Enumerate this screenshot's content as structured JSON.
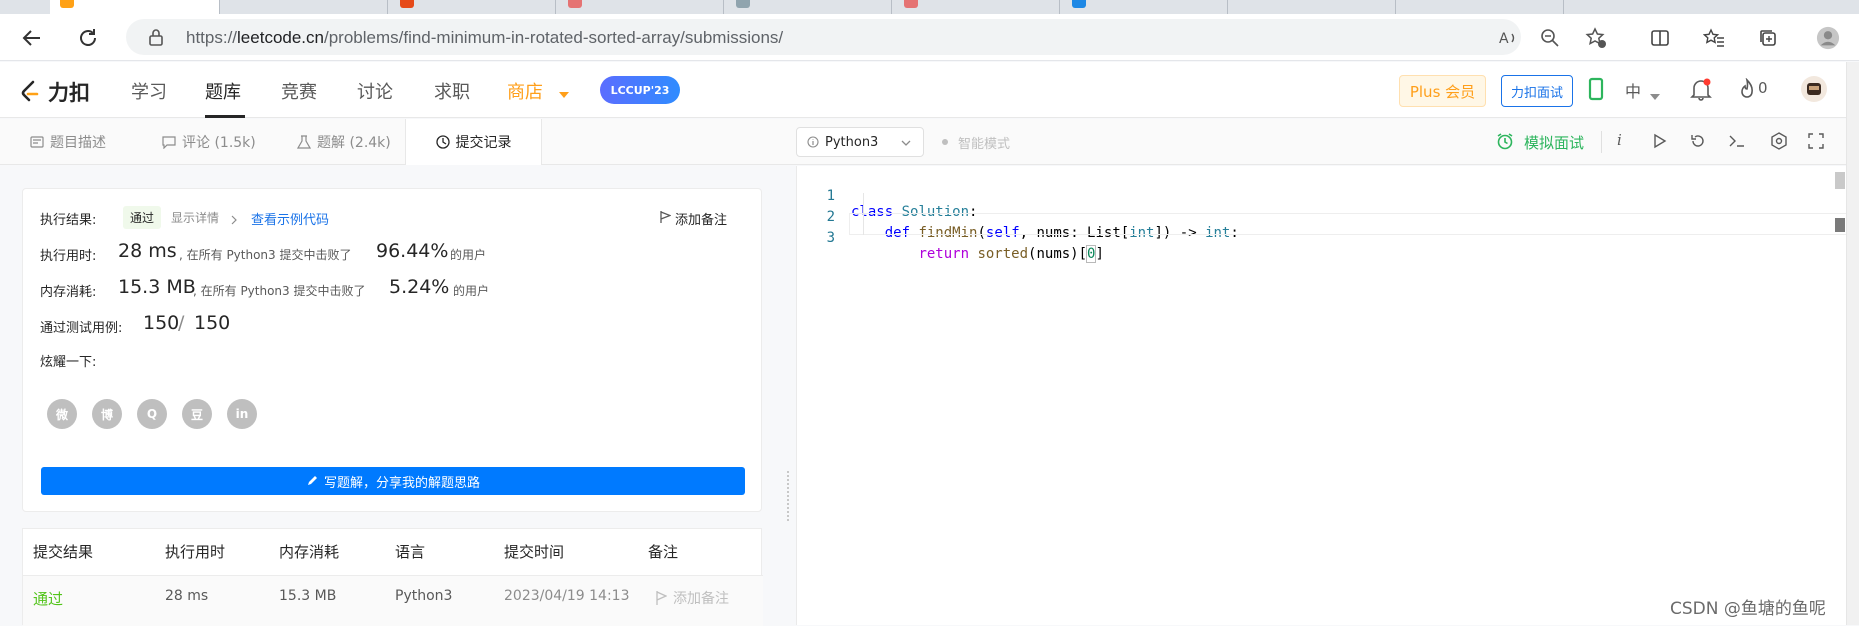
{
  "browser": {
    "url_prefix": "https://",
    "url_host": "leetcode.cn",
    "url_path": "/problems/find-minimum-in-rotated-sorted-array/submissions/"
  },
  "site_nav": {
    "logo_text": "力扣",
    "items": [
      "学习",
      "题库",
      "竞赛",
      "讨论",
      "求职",
      "商店"
    ],
    "lccup_badge": "LCCUP'23",
    "plus_label": "Plus 会员",
    "interview_label": "力扣面试",
    "lang_toggle": "中",
    "fire_count": "0"
  },
  "sub_tabs": {
    "description": "题目描述",
    "comments": "评论 (1.5k)",
    "solutions": "题解 (2.4k)",
    "submissions": "提交记录"
  },
  "editor_toolbar": {
    "language": "Python3",
    "smart_mode": "智能模式",
    "mock_interview": "模拟面试"
  },
  "result_card": {
    "result_label": "执行结果:",
    "status": "通过",
    "show_details": "显示详情",
    "view_sample": "查看示例代码",
    "add_note": "添加备注",
    "runtime_label": "执行用时:",
    "runtime_value": "28 ms",
    "runtime_mid": ", 在所有 Python3 提交中击败了",
    "runtime_pct": "96.44%",
    "runtime_suffix": "的用户",
    "memory_label": "内存消耗:",
    "memory_value": "15.3 MB",
    "memory_mid": ", 在所有 Python3 提交中击败了",
    "memory_pct": "5.24%",
    "memory_suffix": "的用户",
    "tests_label": "通过测试用例:",
    "tests_passed": "150",
    "tests_sep": "/",
    "tests_total": "150",
    "share_label": "炫耀一下:",
    "share_icons": [
      "wechat-icon",
      "weibo-icon",
      "qq-icon",
      "douban-icon",
      "linkedin-icon"
    ],
    "share_glyphs": [
      "微",
      "博",
      "Q",
      "豆",
      "in"
    ],
    "write_button": "写题解，分享我的解题思路"
  },
  "submissions_table": {
    "headers": [
      "提交结果",
      "执行用时",
      "内存消耗",
      "语言",
      "提交时间",
      "备注"
    ],
    "rows": [
      {
        "result": "通过",
        "runtime": "28 ms",
        "memory": "15.3 MB",
        "language": "Python3",
        "time": "2023/04/19 14:13",
        "note": "添加备注"
      }
    ]
  },
  "code": {
    "line_numbers": [
      "1",
      "2",
      "3"
    ],
    "line1": {
      "kw": "class",
      "name": "Solution",
      "tail": ":"
    },
    "line2": {
      "indent": "    ",
      "kw": "def",
      "fn": "findMin",
      "a": "(",
      "self": "self",
      "b": ", nums: List[",
      "t1": "int",
      "c": "]) -> ",
      "t2": "int",
      "d": ":"
    },
    "line3": {
      "indent": "        ",
      "kw": "return",
      "fn": "sorted",
      "a": "(nums)[",
      "idx": "0",
      "b": "]"
    }
  },
  "watermark": "CSDN @鱼塘的鱼呢",
  "colors": {
    "accent_blue": "#007aff",
    "pass_green": "#52c41a",
    "shop_orange": "#ff9f1a"
  }
}
